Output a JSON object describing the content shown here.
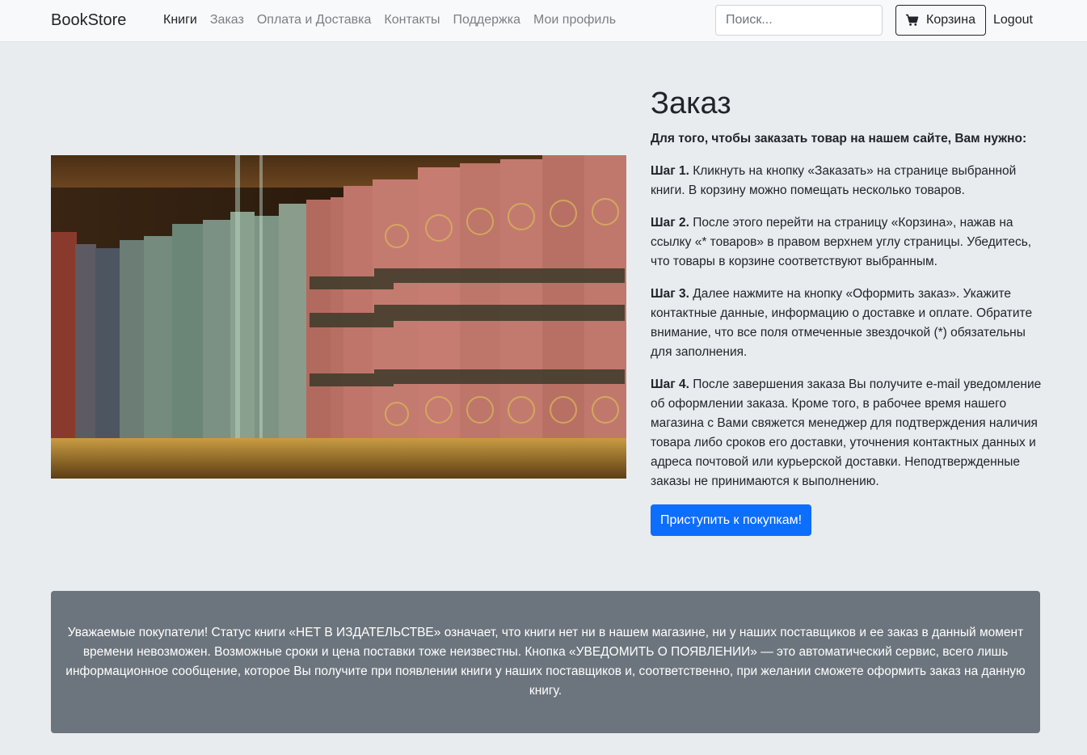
{
  "navbar": {
    "brand": "BookStore",
    "links": [
      {
        "label": "Книги",
        "active": true
      },
      {
        "label": "Заказ",
        "active": false
      },
      {
        "label": "Оплата и Доставка",
        "active": false
      },
      {
        "label": "Контакты",
        "active": false
      },
      {
        "label": "Поддержка",
        "active": false
      },
      {
        "label": "Мои профиль",
        "active": false
      }
    ],
    "search_placeholder": "Поиск...",
    "cart_label": "Корзина",
    "cart_icon": "cart-icon",
    "logout_label": "Logout"
  },
  "hero": {
    "image": "bookshelf-photo",
    "title": "Заказ",
    "lead": "Для того, чтобы заказать товар на нашем сайте, Вам нужно:",
    "steps": [
      {
        "label": "Шаг 1.",
        "text": " Кликнуть на кнопку «Заказать» на странице выбранной книги. В корзину можно помещать несколько товаров."
      },
      {
        "label": "Шаг 2.",
        "text": " После этого перейти на страницу «Корзина», нажав на ссылку «* товаров» в правом верхнем углу страницы. Убедитесь, что товары в корзине соответствуют выбранным."
      },
      {
        "label": "Шаг 3.",
        "text": " Далее нажмите на кнопку «Оформить заказ». Укажите контактные данные, информацию о доставке и оплате. Обратите внимание, что все поля отмеченные звездочкой (*) обязательны для заполнения."
      },
      {
        "label": "Шаг 4.",
        "text": " После завершения заказа Вы получите e-mail уведомление об оформлении заказа. Кроме того, в рабочее время нашего магазина с Вами свяжется менеджер для подтверждения наличия товара либо сроков его доставки, уточнения контактных данных и адреса почтовой или курьерской доставки. Неподтвержденные заказы не принимаются к выполнению."
      }
    ],
    "button_label": "Приступить к покупкам!",
    "button_color": "#0d6efd"
  },
  "info": {
    "text": "Уважаемые покупатели! Статус книги «НЕТ В ИЗДАТЕЛЬСТВЕ» означает, что книги нет ни в нашем магазине, ни у наших поставщиков и ее заказ в данный момент времени невозможен. Возможные сроки и цена поставки тоже неизвестны. Кнопка «УВЕДОМИТЬ О ПОЯВЛЕНИИ» — это автоматический сервис, всего лишь информационное сообщение, которое Вы получите при появлении книги у наших поставщиков и, соответственно, при желании сможете оформить заказ на данную книгу.",
    "background": "#6c757d"
  }
}
